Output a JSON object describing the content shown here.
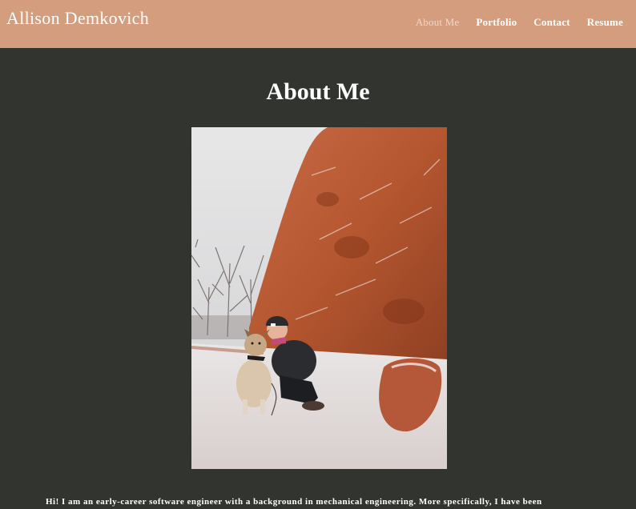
{
  "header": {
    "site_title": "Allison Demkovich",
    "nav": [
      {
        "label": "About Me",
        "active": true
      },
      {
        "label": "Portfolio",
        "active": false
      },
      {
        "label": "Contact",
        "active": false
      },
      {
        "label": "Resume",
        "active": false
      }
    ]
  },
  "main": {
    "title": "About Me",
    "intro": "Hi! I am an early-career software engineer with a background in mechanical engineering. More specifically, I have been"
  },
  "colors": {
    "header_bg": "#d49e7e",
    "page_bg": "#32352f",
    "active_nav": "#f1d6c6"
  }
}
